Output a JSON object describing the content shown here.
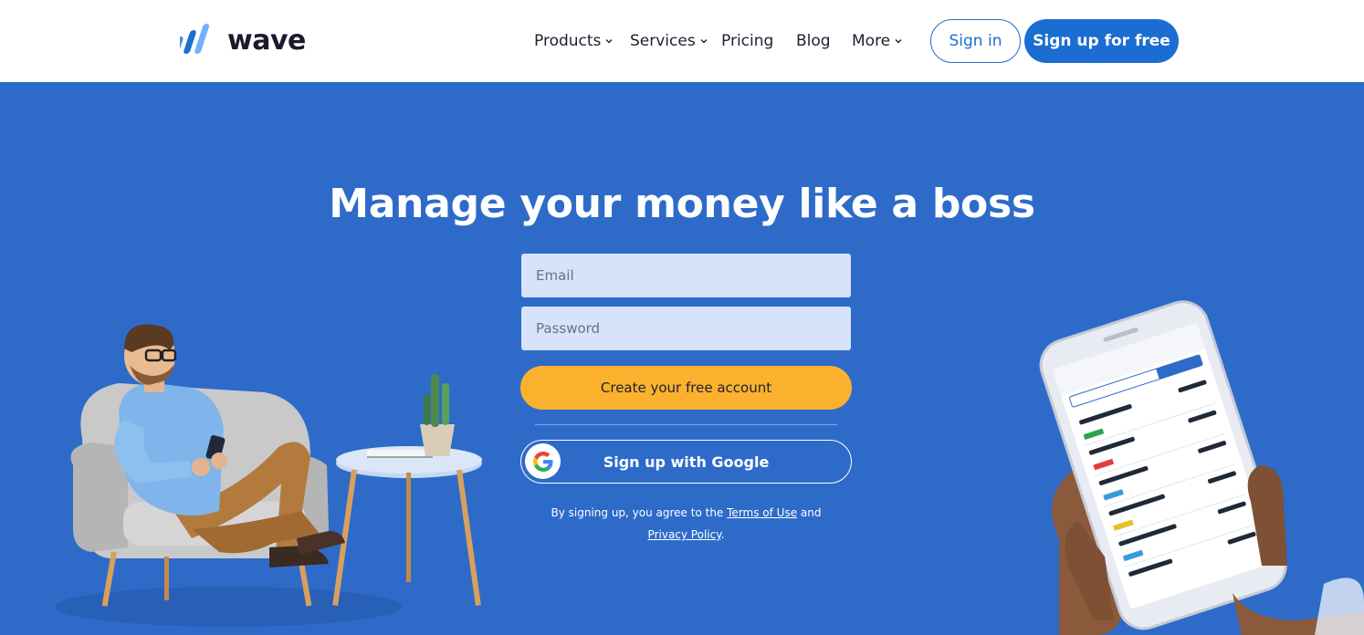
{
  "brand": {
    "name": "wave"
  },
  "nav": {
    "products": "Products",
    "services": "Services",
    "pricing": "Pricing",
    "blog": "Blog",
    "more": "More"
  },
  "header": {
    "signin_label": "Sign in",
    "signup_label": "Sign up for free"
  },
  "hero": {
    "headline": "Manage your money like a boss"
  },
  "form": {
    "email_placeholder": "Email",
    "password_placeholder": "Password",
    "create_label": "Create your free account",
    "google_label": "Sign up with Google",
    "legal_prefix": "By signing up, you agree to the",
    "terms_link": "Terms of Use",
    "legal_and": "and",
    "privacy_link": "Privacy Policy",
    "legal_end": "."
  },
  "colors": {
    "brand_blue": "#1b6dd1",
    "hero_bg": "#2e6bc9",
    "cta_yellow": "#fbb12e",
    "field_bg": "#d6e3fb"
  },
  "icons": {
    "logo": "wave-logo-icon",
    "chevron": "chevron-down-icon",
    "google": "google-g-icon"
  }
}
